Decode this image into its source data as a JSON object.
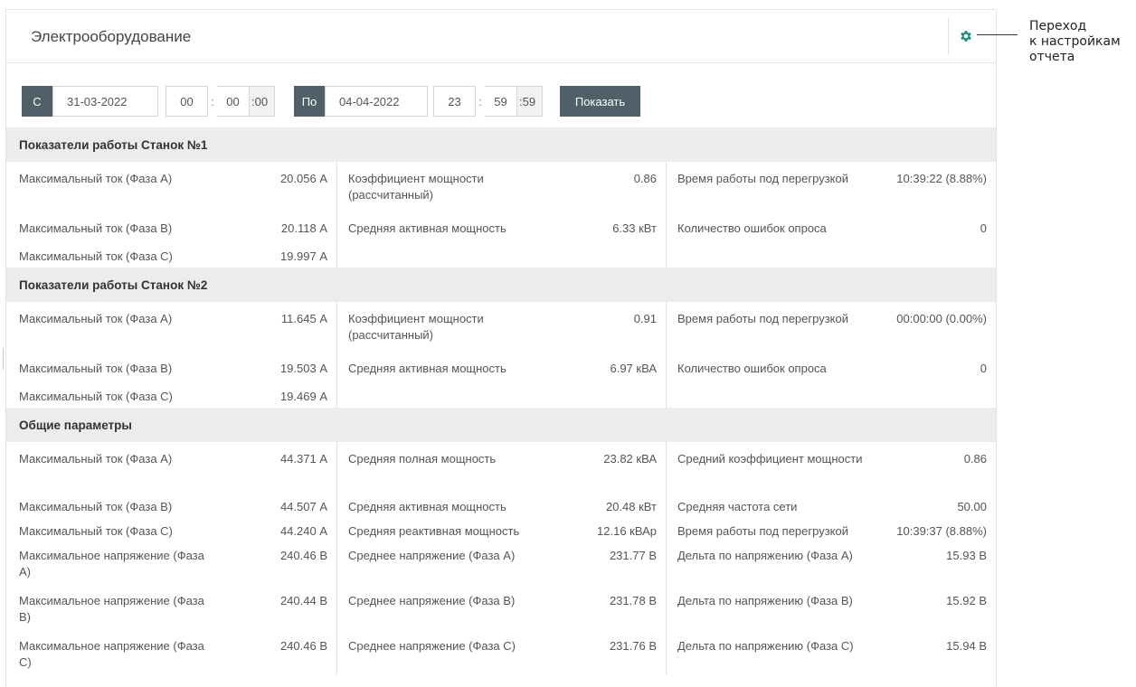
{
  "header": {
    "title": "Электрооборудование",
    "settings_icon": "gear-icon",
    "accent": "#1e8a7a"
  },
  "callout": {
    "line1": "Переход",
    "line2": "к настройкам",
    "line3": "отчета"
  },
  "filter": {
    "from_label": "С",
    "from_date": "31-03-2022",
    "from_hh": "00",
    "from_mm": "00",
    "from_ss": ":00",
    "to_label": "По",
    "to_date": "04-04-2022",
    "to_hh": "23",
    "to_mm": "59",
    "to_ss": ":59",
    "colon": ":",
    "show_label": "Показать"
  },
  "sections": {
    "s1": {
      "title": "Показатели работы Станок №1",
      "r1": {
        "a_label": "Максимальный ток (Фаза А)",
        "a_value": "20.056 А",
        "b_label": "Коэффициент мощности (рассчитанный)",
        "b_value": "0.86",
        "c_label": "Время работы под перегрузкой",
        "c_value": "10:39:22 (8.88%)"
      },
      "r2": {
        "a_label": "Максимальный ток (Фаза В)",
        "a_value": "20.118 А",
        "b_label": "Средняя активная мощность",
        "b_value": "6.33 кВт",
        "c_label": "Количество ошибок опроса",
        "c_value": "0"
      },
      "r3": {
        "a_label": "Максимальный ток (Фаза С)",
        "a_value": "19.997 А"
      }
    },
    "s2": {
      "title": "Показатели работы Станок №2",
      "r1": {
        "a_label": "Максимальный ток (Фаза А)",
        "a_value": "11.645 А",
        "b_label": "Коэффициент мощности (рассчитанный)",
        "b_value": "0.91",
        "c_label": "Время работы под перегрузкой",
        "c_value": "00:00:00 (0.00%)"
      },
      "r2": {
        "a_label": "Максимальный ток (Фаза В)",
        "a_value": "19.503 А",
        "b_label": "Средняя активная мощность",
        "b_value": "6.97 кВА",
        "c_label": "Количество ошибок опроса",
        "c_value": "0"
      },
      "r3": {
        "a_label": "Максимальный ток (Фаза С)",
        "a_value": "19.469 А"
      }
    },
    "s3": {
      "title": "Общие параметры",
      "r1": {
        "a_label": "Максимальный ток (Фаза А)",
        "a_value": "44.371 А",
        "b_label": "Средняя полная мощность",
        "b_value": "23.82 кВА",
        "c_label": "Средний коэффициент мощности",
        "c_value": "0.86"
      },
      "r2": {
        "a_label": "Максимальный ток (Фаза В)",
        "a_value": "44.507 А",
        "b_label": "Средняя активная мощность",
        "b_value": "20.48 кВт",
        "c_label": "Средняя частота сети",
        "c_value": "50.00"
      },
      "r3": {
        "a_label": "Максимальный ток (Фаза С)",
        "a_value": "44.240 А",
        "b_label": "Средняя реактивная мощность",
        "b_value": "12.16 кВАр",
        "c_label": "Время работы под перегрузкой",
        "c_value": "10:39:37 (8.88%)"
      },
      "r4": {
        "a_label": "Максимальное напряжение (Фаза А)",
        "a_value": "240.46 В",
        "b_label": "Среднее напряжение (Фаза А)",
        "b_value": "231.77 В",
        "c_label": "Дельта по напряжению (Фаза А)",
        "c_value": "15.93 В"
      },
      "r5": {
        "a_label": "Максимальное напряжение (Фаза В)",
        "a_value": "240.44 В",
        "b_label": "Среднее напряжение (Фаза В)",
        "b_value": "231.78 В",
        "c_label": "Дельта по напряжению (Фаза В)",
        "c_value": "15.92 В"
      },
      "r6": {
        "a_label": "Максимальное напряжение (Фаза С)",
        "a_value": "240.46 В",
        "b_label": "Среднее напряжение (Фаза С)",
        "b_value": "231.76 В",
        "c_label": "Дельта по напряжению (Фаза С)",
        "c_value": "15.94 В"
      }
    }
  }
}
